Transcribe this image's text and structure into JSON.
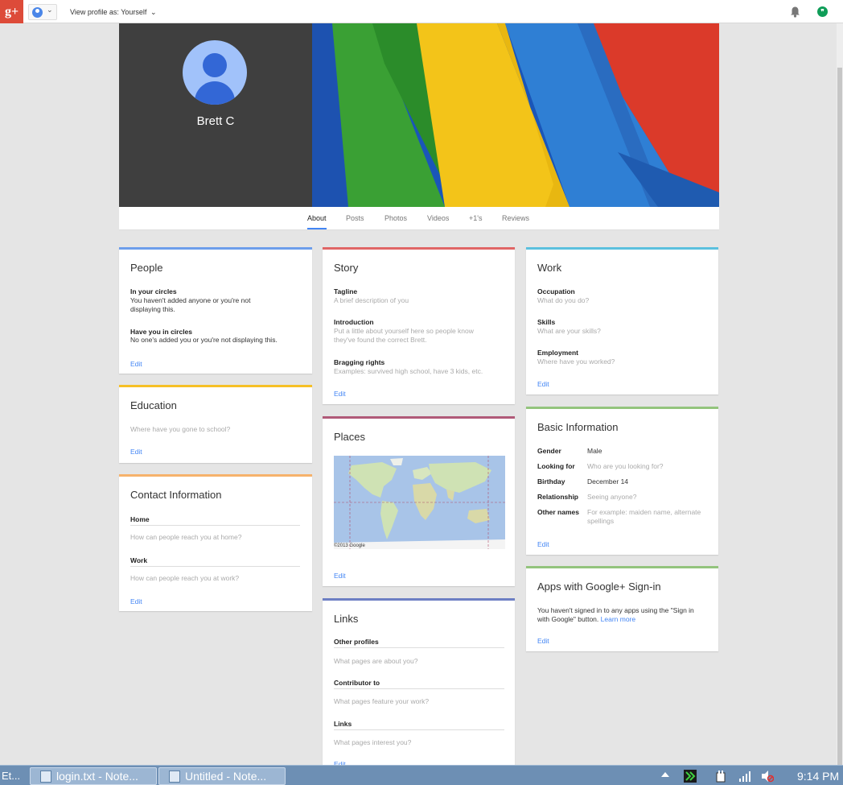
{
  "topbar": {
    "logo": "g+",
    "view_as_label": "View profile as:",
    "view_as_value": "Yourself",
    "chevron": "⌄"
  },
  "profile": {
    "name": "Brett C"
  },
  "tabs": [
    {
      "label": "About",
      "active": true
    },
    {
      "label": "Posts"
    },
    {
      "label": "Photos"
    },
    {
      "label": "Videos"
    },
    {
      "label": "+1's"
    },
    {
      "label": "Reviews"
    }
  ],
  "people": {
    "title": "People",
    "in_circles_label": "In your circles",
    "in_circles_text_1": "You haven't added anyone or you're not",
    "in_circles_text_2": "displaying this.",
    "have_you_label": "Have you in circles",
    "have_you_text": "No one's added you or you're not displaying this.",
    "edit": "Edit"
  },
  "education": {
    "title": "Education",
    "placeholder": "Where have you gone to school?",
    "edit": "Edit"
  },
  "contact": {
    "title": "Contact Information",
    "home_label": "Home",
    "home_placeholder": "How can people reach you at home?",
    "work_label": "Work",
    "work_placeholder": "How can people reach you at work?",
    "edit": "Edit"
  },
  "story": {
    "title": "Story",
    "tagline_label": "Tagline",
    "tagline_placeholder": "A brief description of you",
    "intro_label": "Introduction",
    "intro_placeholder_1": "Put a little about yourself here so people know",
    "intro_placeholder_2": "they've found the correct Brett.",
    "bragging_label": "Bragging rights",
    "bragging_placeholder": "Examples: survived high school, have 3 kids, etc.",
    "edit": "Edit"
  },
  "places": {
    "title": "Places",
    "map_copyright": "©2013 Google",
    "edit": "Edit"
  },
  "links": {
    "title": "Links",
    "other_label": "Other profiles",
    "other_placeholder": "What pages are about you?",
    "contrib_label": "Contributor to",
    "contrib_placeholder": "What pages feature your work?",
    "links_label": "Links",
    "links_placeholder": "What pages interest you?",
    "edit": "Edit"
  },
  "work": {
    "title": "Work",
    "occupation_label": "Occupation",
    "occupation_placeholder": "What do you do?",
    "skills_label": "Skills",
    "skills_placeholder": "What are your skills?",
    "employment_label": "Employment",
    "employment_placeholder": "Where have you worked?",
    "edit": "Edit"
  },
  "basic": {
    "title": "Basic Information",
    "gender_label": "Gender",
    "gender_value": "Male",
    "looking_label": "Looking for",
    "looking_placeholder": "Who are you looking for?",
    "birthday_label": "Birthday",
    "birthday_value": "December 14",
    "relationship_label": "Relationship",
    "relationship_placeholder": "Seeing anyone?",
    "other_names_label": "Other names",
    "other_names_placeholder_1": "For example: maiden name, alternate",
    "other_names_placeholder_2": "spellings",
    "edit": "Edit"
  },
  "apps": {
    "title": "Apps with Google+ Sign-in",
    "text_1": "You haven't signed in to any apps using the \"Sign in",
    "text_2": "with Google\" button.",
    "learn_more": "Learn more",
    "edit": "Edit"
  },
  "taskbar": {
    "start_text": "Et...",
    "task_1": "login.txt - Note...",
    "task_2": "Untitled - Note...",
    "clock": "9:14 PM"
  },
  "colors": {
    "people": "#6d9eeb",
    "education": "#f6c026",
    "contact": "#f6b26b",
    "story": "#e06666",
    "places": "#b05a78",
    "links": "#6d7fc4",
    "work": "#5bc0de",
    "basic": "#93c47d",
    "apps": "#93c47d"
  }
}
